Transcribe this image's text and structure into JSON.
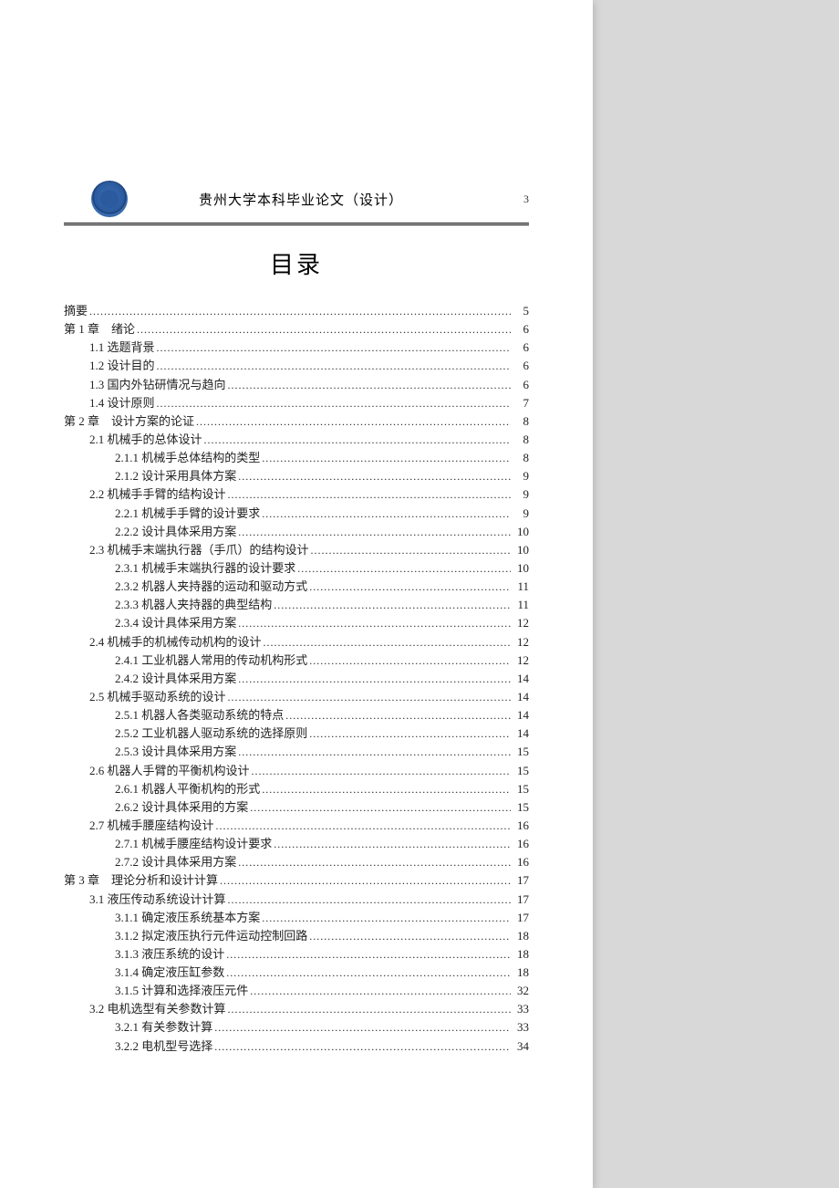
{
  "header": {
    "title": "贵州大学本科毕业论文（设计）",
    "page_number": "3"
  },
  "toc_heading": "目录",
  "toc": [
    {
      "level": 1,
      "label": "摘要",
      "page": "5"
    },
    {
      "level": 1,
      "label": "第 1 章 绪论",
      "page": "6"
    },
    {
      "level": 2,
      "label": "1.1 选题背景",
      "page": "6"
    },
    {
      "level": 2,
      "label": "1.2 设计目的",
      "page": "6"
    },
    {
      "level": 2,
      "label": "1.3 国内外钻研情况与趋向",
      "page": "6"
    },
    {
      "level": 2,
      "label": "1.4 设计原则",
      "page": "7"
    },
    {
      "level": 1,
      "label": "第 2 章 设计方案的论证",
      "page": "8"
    },
    {
      "level": 2,
      "label": "2.1 机械手的总体设计",
      "page": "8"
    },
    {
      "level": 3,
      "label": "2.1.1 机械手总体结构的类型",
      "page": "8"
    },
    {
      "level": 3,
      "label": "2.1.2 设计采用具体方案",
      "page": "9"
    },
    {
      "level": 2,
      "label": "2.2 机械手手臂的结构设计",
      "page": "9"
    },
    {
      "level": 3,
      "label": "2.2.1 机械手手臂的设计要求",
      "page": "9"
    },
    {
      "level": 3,
      "label": "2.2.2 设计具体采用方案",
      "page": "10"
    },
    {
      "level": 2,
      "label": "2.3 机械手末端执行器（手爪）的结构设计",
      "page": "10"
    },
    {
      "level": 3,
      "label": "2.3.1 机械手末端执行器的设计要求",
      "page": "10"
    },
    {
      "level": 3,
      "label": "2.3.2 机器人夹持器的运动和驱动方式",
      "page": "11"
    },
    {
      "level": 3,
      "label": "2.3.3 机器人夹持器的典型结构",
      "page": "11"
    },
    {
      "level": 3,
      "label": "2.3.4 设计具体采用方案",
      "page": "12"
    },
    {
      "level": 2,
      "label": "2.4 机械手的机械传动机构的设计",
      "page": "12"
    },
    {
      "level": 3,
      "label": "2.4.1 工业机器人常用的传动机构形式",
      "page": "12"
    },
    {
      "level": 3,
      "label": "2.4.2 设计具体采用方案",
      "page": "14"
    },
    {
      "level": 2,
      "label": "2.5 机械手驱动系统的设计",
      "page": "14"
    },
    {
      "level": 3,
      "label": "2.5.1 机器人各类驱动系统的特点",
      "page": "14"
    },
    {
      "level": 3,
      "label": "2.5.2 工业机器人驱动系统的选择原则",
      "page": "14"
    },
    {
      "level": 3,
      "label": "2.5.3 设计具体采用方案",
      "page": "15"
    },
    {
      "level": 2,
      "label": "2.6 机器人手臂的平衡机构设计",
      "page": "15"
    },
    {
      "level": 3,
      "label": "2.6.1 机器人平衡机构的形式",
      "page": "15"
    },
    {
      "level": 3,
      "label": "2.6.2 设计具体采用的方案",
      "page": "15"
    },
    {
      "level": 2,
      "label": "2.7 机械手腰座结构设计",
      "page": "16"
    },
    {
      "level": 3,
      "label": "2.7.1 机械手腰座结构设计要求",
      "page": "16"
    },
    {
      "level": 3,
      "label": "2.7.2 设计具体采用方案",
      "page": "16"
    },
    {
      "level": 1,
      "label": "第 3 章 理论分析和设计计算",
      "page": "17"
    },
    {
      "level": 2,
      "label": "3.1 液压传动系统设计计算",
      "page": "17"
    },
    {
      "level": 3,
      "label": "3.1.1 确定液压系统基本方案",
      "page": "17"
    },
    {
      "level": 3,
      "label": "3.1.2 拟定液压执行元件运动控制回路",
      "page": "18"
    },
    {
      "level": 3,
      "label": "3.1.3 液压系统的设计",
      "page": "18"
    },
    {
      "level": 3,
      "label": "3.1.4 确定液压缸参数",
      "page": "18"
    },
    {
      "level": 3,
      "label": "3.1.5 计算和选择液压元件",
      "page": "32"
    },
    {
      "level": 2,
      "label": "3.2 电机选型有关参数计算",
      "page": "33"
    },
    {
      "level": 3,
      "label": "3.2.1 有关参数计算",
      "page": "33"
    },
    {
      "level": 3,
      "label": "3.2.2 电机型号选择",
      "page": "34"
    }
  ]
}
